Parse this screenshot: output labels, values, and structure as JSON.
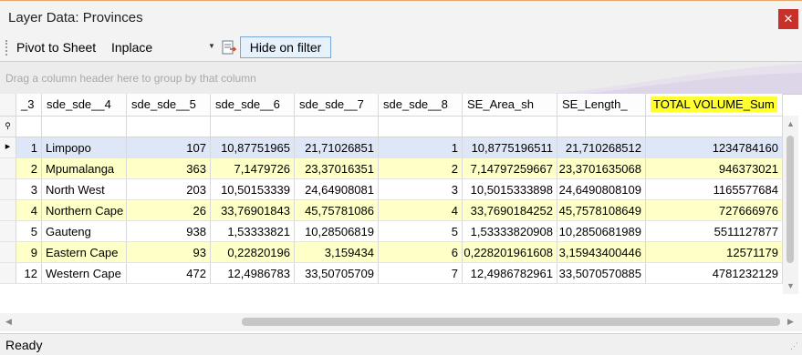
{
  "window": {
    "title": "Layer Data: Provinces",
    "close_glyph": "✕"
  },
  "toolbar": {
    "pivot_label": "Pivot to Sheet",
    "mode_value": "Inplace",
    "hide_filter_label": "Hide on filter"
  },
  "grid": {
    "group_hint": "Drag a column header here to group by that column",
    "columns": [
      "_3",
      "sde_sde__4",
      "sde_sde__5",
      "sde_sde__6",
      "sde_sde__7",
      "sde_sde__8",
      "SE_Area_sh",
      "SE_Length_",
      "TOTAL VOLUME_Sum"
    ],
    "rows": [
      [
        "1",
        "Limpopo",
        "107",
        "10,87751965",
        "21,71026851",
        "1",
        "10,8775196511",
        "21,710268512",
        "1234784160"
      ],
      [
        "2",
        "Mpumalanga",
        "363",
        "7,1479726",
        "23,37016351",
        "2",
        "7,14797259667",
        "23,3701635068",
        "946373021"
      ],
      [
        "3",
        "North West",
        "203",
        "10,50153339",
        "24,64908081",
        "3",
        "10,5015333898",
        "24,6490808109",
        "1165577684"
      ],
      [
        "4",
        "Northern Cape",
        "26",
        "33,76901843",
        "45,75781086",
        "4",
        "33,7690184252",
        "45,7578108649",
        "727666976"
      ],
      [
        "5",
        "Gauteng",
        "938",
        "1,53333821",
        "10,28506819",
        "5",
        "1,53333820908",
        "10,2850681989",
        "5511127877"
      ],
      [
        "9",
        "Eastern Cape",
        "93",
        "0,22820196",
        "3,159434",
        "6",
        "0,228201961608",
        "3,15943400446",
        "12571179"
      ],
      [
        "12",
        "Western Cape",
        "472",
        "12,4986783",
        "33,50705709",
        "7",
        "12,4986782961",
        "33,5070570885",
        "4781232129"
      ]
    ]
  },
  "colors": {
    "row_alt": "#ffffc8",
    "row_selected": "#dde7f7",
    "highlight_header": "#ffff2e",
    "close_red": "#c8302a"
  },
  "status": {
    "text": "Ready"
  }
}
